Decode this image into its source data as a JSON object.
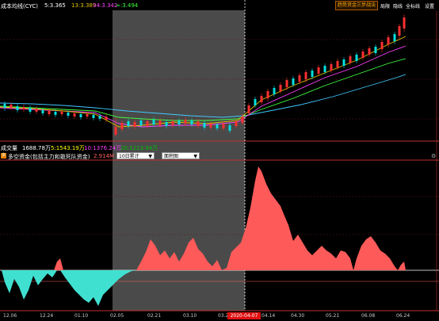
{
  "indicator_bar": {
    "name": "成本均线(CYC)",
    "v1": "5:3.365",
    "v2": "13:3.389",
    "v3": "34:3.342",
    "v4": "∞:3.494",
    "v1_color": "#ffffff",
    "v2_color": "#e0c000",
    "v3_color": "#ff40ff",
    "v4_color": "#40ff40"
  },
  "toolbar": {
    "strategy_label": "趋势资金三步战法",
    "menu_items": [
      "局限",
      "隐线",
      "全标线",
      "设置"
    ]
  },
  "volume_bar": {
    "name": "成交量",
    "v1": "1688.78万",
    "v2": "5:1543.19万",
    "v3": "10:1376.24万",
    "v4": "20:1213.94万",
    "v2_color": "#ffff00",
    "v3_color": "#ff40ff",
    "v4_color": "#00c000"
  },
  "fund_bar": {
    "name": "多空资金(包括主力和敢死队资金)",
    "value": "2.914M",
    "value_color": "#ff6060",
    "period_select": "10日累计",
    "chart_type_select": "面积图"
  },
  "x_axis": {
    "labels": [
      "12.06",
      "12.24",
      "01.10",
      "02.05",
      "02.21",
      "03.10",
      "03.26",
      "04.14",
      "04.30",
      "05.21",
      "06.08",
      "06.24"
    ],
    "cursor_date": "2020-04-07"
  },
  "colors": {
    "up": "#ff3030",
    "down": "#00e0e0",
    "positive_area": "#ff5a5a",
    "negative_area": "#40e0d0",
    "highlight_region": "#4a4a4a"
  },
  "chart_data": [
    {
      "type": "line",
      "title": "成本均线(CYC)",
      "series": [
        {
          "name": "5",
          "last": 3.365
        },
        {
          "name": "13",
          "last": 3.389
        },
        {
          "name": "34",
          "last": 3.342
        },
        {
          "name": "∞",
          "last": 3.494
        }
      ]
    },
    {
      "type": "area",
      "title": "多空资金(包括主力和敢死队资金)",
      "categories": [
        "12.06",
        "12.24",
        "01.10",
        "02.05",
        "02.21",
        "03.10",
        "03.26",
        "04.14",
        "04.30",
        "05.21",
        "06.08",
        "06.24"
      ],
      "series": [
        {
          "name": "2.914M",
          "values": [
            -1.2,
            -1.6,
            -1.8,
            -0.4,
            1.1,
            1.4,
            0.2,
            4.3,
            1.6,
            1.0,
            1.5,
            0.3
          ]
        }
      ]
    }
  ]
}
